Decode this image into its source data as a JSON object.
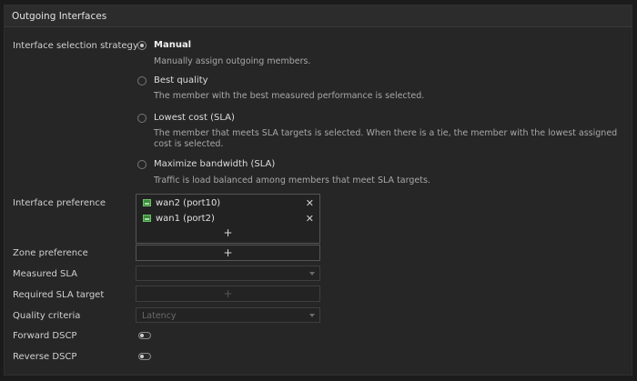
{
  "panel": {
    "title": "Outgoing Interfaces"
  },
  "strategy": {
    "label": "Interface selection strategy",
    "options": [
      {
        "title": "Manual",
        "desc": "Manually assign outgoing members.",
        "selected": true
      },
      {
        "title": "Best quality",
        "desc": "The member with the best measured performance is selected.",
        "selected": false
      },
      {
        "title": "Lowest cost (SLA)",
        "desc": "The member that meets SLA targets is selected. When there is a tie, the member with the lowest assigned cost is selected.",
        "selected": false
      },
      {
        "title": "Maximize bandwidth (SLA)",
        "desc": "Traffic is load balanced among members that meet SLA targets.",
        "selected": false
      }
    ]
  },
  "interface_preference": {
    "label": "Interface preference",
    "members": [
      "wan2 (port10)",
      "wan1 (port2)"
    ],
    "add_symbol": "+",
    "remove_symbol": "✕"
  },
  "zone_preference": {
    "label": "Zone preference",
    "add_symbol": "+"
  },
  "measured_sla": {
    "label": "Measured SLA",
    "value": ""
  },
  "required_sla": {
    "label": "Required SLA target",
    "add_symbol": "+"
  },
  "quality_criteria": {
    "label": "Quality criteria",
    "value": "Latency"
  },
  "forward_dscp": {
    "label": "Forward DSCP",
    "enabled": false
  },
  "reverse_dscp": {
    "label": "Reverse DSCP",
    "enabled": false
  }
}
